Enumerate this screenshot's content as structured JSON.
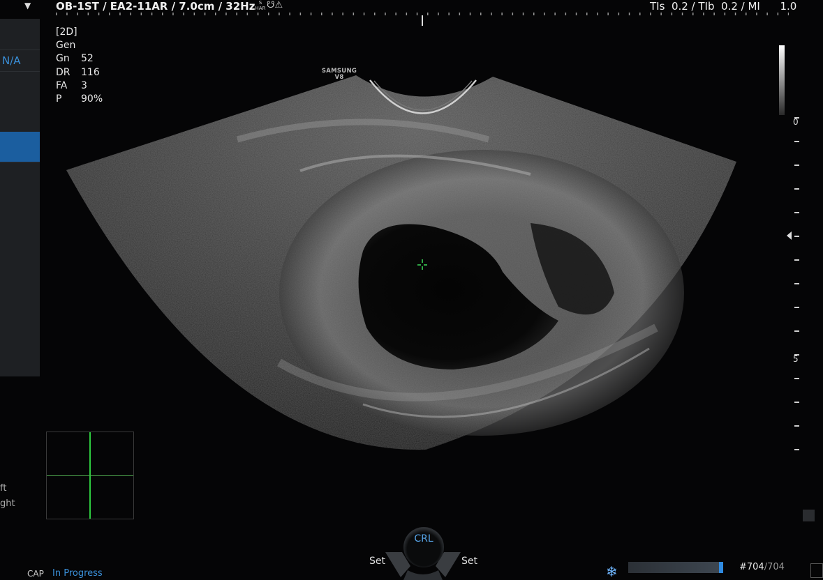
{
  "header": {
    "probe_info": "OB-1ST / EA2-11AR / 7.0cm / 32Hz",
    "har_icon_top": "S",
    "har_icon_bottom": "HAR",
    "tis_info": "TIs  0.2 / TIb  0.2 / MI      1.0",
    "dropdown_icon": "chevron-down-icon"
  },
  "sidebar": {
    "item_na": "N/A",
    "partial_left": "ft",
    "partial_right": "ght"
  },
  "params": {
    "mode": "[2D]",
    "preset": "Gen",
    "rows": [
      {
        "key": "Gn",
        "value": "52"
      },
      {
        "key": "DR",
        "value": "116"
      },
      {
        "key": "FA",
        "value": "3"
      },
      {
        "key": "P",
        "value": "90%"
      }
    ]
  },
  "brand": {
    "line1": "SAMSUNG",
    "line2": "V8"
  },
  "depth_scale": {
    "labels": [
      "0",
      "5"
    ]
  },
  "measure_knob": {
    "label": "CRL",
    "set_left": "Set",
    "set_right": "Set"
  },
  "status": {
    "cap_label": "CAP",
    "state": "In Progress",
    "freeze_icon": "snowflake-icon",
    "frame_current": "#704",
    "frame_total": "/704"
  },
  "colors": {
    "accent_blue": "#3a8fd8",
    "selection_blue": "#1b5e9f",
    "cursor_green": "#2ecc40"
  }
}
